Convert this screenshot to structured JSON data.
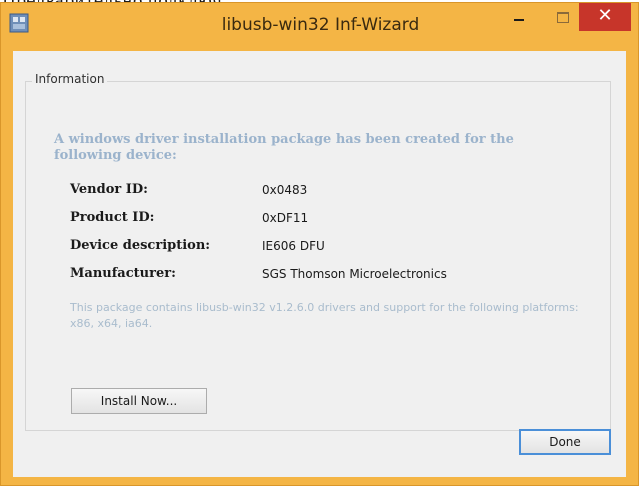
{
  "top_strip": "Предварительно подключ",
  "window": {
    "title": "libusb-win32 Inf-Wizard",
    "buttons": {
      "minimize": "–",
      "maximize": "□",
      "close": "✕"
    }
  },
  "group": {
    "label": "Information",
    "heading": "A windows driver installation package has been created for the following device:",
    "fields": [
      {
        "label": "Vendor ID:",
        "value": "0x0483"
      },
      {
        "label": "Product ID:",
        "value": "0xDF11"
      },
      {
        "label": "Device description:",
        "value": "IE606 DFU"
      },
      {
        "label": "Manufacturer:",
        "value": "SGS Thomson Microelectronics"
      }
    ],
    "note": "This package contains libusb-win32 v1.2.6.0 drivers and support for the following platforms: x86, x64, ia64."
  },
  "buttons": {
    "install": "Install Now...",
    "done": "Done"
  },
  "colors": {
    "title_bar": "#f4b545",
    "close_button": "#c7352a",
    "heading_text": "#9bb3cc",
    "note_text": "#a9bccd",
    "focus_border": "#4a8fd8"
  },
  "icons": {
    "app": "libusb-app-icon"
  }
}
